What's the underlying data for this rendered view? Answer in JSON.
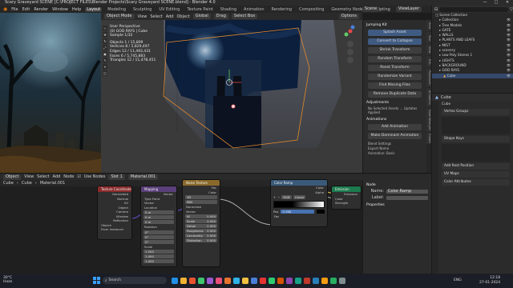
{
  "window": {
    "title": "Scary Graveyard SCENE [C:\\PROJECT FILES\\Blender Projects\\Scary Graveyard SCENE.blend] - Blender 4.0",
    "controls": [
      "—",
      "□",
      "✕"
    ]
  },
  "menubar": {
    "items": [
      "File",
      "Edit",
      "Render",
      "Window",
      "Help"
    ],
    "workspaces": [
      "Layout",
      "Modeling",
      "Sculpting",
      "UV Editing",
      "Texture Paint",
      "Shading",
      "Animation",
      "Rendering",
      "Compositing",
      "Geometry Nodes",
      "Scripting"
    ],
    "active_workspace": "Layout",
    "scene": "Scene",
    "view_layer": "ViewLayer"
  },
  "viewport_header": {
    "items": [
      "Object Mode",
      "View",
      "Select",
      "Add",
      "Object"
    ],
    "orientation": "Global",
    "drag": "Drag",
    "snap": "Select Box",
    "options": "Options"
  },
  "viewport_stats": {
    "lines": [
      "User Perspective",
      "(0) GOD RAYS | Cube",
      "Sample 1/32",
      "",
      "Objects    1 / 15,809",
      "Vertices   8 / 5,829,497",
      "Edges     12 / 11,492,431",
      "Faces      6 / 5,745,883",
      "Triangles  12 / 11,478,451"
    ]
  },
  "npanel": {
    "header": "Jumping Kit",
    "buttons": [
      "Splash Asset",
      "Convert to Collapse",
      "Shrink Transform",
      "Random Transform",
      "Reset Transform",
      "Randomize Variant",
      "Find Missing Files",
      "Remove Duplicate Data"
    ],
    "adjustments_label": "Adjustments",
    "adjustments_note": "No Selected Assets ... Updates Applied",
    "animations_label": "Animations",
    "add_animation": "Add Animation",
    "motion_label": "Make Dominant Animation",
    "fields": [
      "Blend Settings",
      "Export Name",
      "Animation: Basis"
    ]
  },
  "tools": [
    "⊹",
    "✥",
    "↻",
    "⤢",
    "▣",
    "✎",
    "⌖",
    "◫"
  ],
  "side_tabs": [
    "Item",
    "Tool",
    "View",
    "Edit",
    "Polyhaven",
    "Animation",
    "Node Wrangler",
    "Create"
  ],
  "outliner": {
    "search_placeholder": "",
    "rows": [
      {
        "name": "Scene Collection",
        "indent": 0
      },
      {
        "name": "Collection",
        "indent": 1
      },
      {
        "name": "Tree Models",
        "indent": 1
      },
      {
        "name": "GATE",
        "indent": 1
      },
      {
        "name": "WALLS",
        "indent": 1
      },
      {
        "name": "PLANTS AND LEAFS",
        "indent": 1
      },
      {
        "name": "MIST",
        "indent": 1
      },
      {
        "name": "scenery",
        "indent": 1
      },
      {
        "name": "Low Poly Stones 1",
        "indent": 1
      },
      {
        "name": "LIGHTS",
        "indent": 1
      },
      {
        "name": "BACKGROUND",
        "indent": 1
      },
      {
        "name": "GOD RAYS",
        "indent": 1
      },
      {
        "name": "Cube",
        "indent": 2,
        "selected": true
      }
    ]
  },
  "node_editor": {
    "header": [
      "Object",
      "View",
      "Select",
      "Add",
      "Node",
      "Use Nodes"
    ],
    "object": "Cube",
    "material": "Material.001",
    "slot": "Slot 1",
    "nodes": {
      "texcoord": {
        "title": "Texture Coordinate",
        "outputs": [
          "Generated",
          "Normal",
          "UV",
          "Object",
          "Camera",
          "Window",
          "Reflection"
        ],
        "object_label": "Object:",
        "from_instancer": "From Instancer"
      },
      "mapping": {
        "title": "Mapping",
        "output": "Vector",
        "type_label": "Type",
        "type_value": "Point",
        "vector": "Vector",
        "location": "Location",
        "rotation": "Rotation",
        "scale": "Scale",
        "vals_loc": [
          "0 m",
          "0 m",
          "0 m"
        ],
        "vals_rot": [
          "0°",
          "0°",
          "0°"
        ],
        "vals_scale": [
          "1.000",
          "1.000",
          "1.000"
        ]
      },
      "noise": {
        "title": "Noise Texture",
        "outputs": [
          "Fac",
          "Color"
        ],
        "dim": "3D",
        "type": "fBM",
        "normalize": "Normalize",
        "vector": "Vector",
        "fields": [
          {
            "k": "W",
            "v": "0.000"
          },
          {
            "k": "Scale",
            "v": "4.000"
          },
          {
            "k": "Detail",
            "v": "2.000"
          },
          {
            "k": "Roughness",
            "v": "0.500"
          },
          {
            "k": "Lacunarity",
            "v": "2.000"
          },
          {
            "k": "Distortion",
            "v": "0.000"
          }
        ]
      },
      "colorramp": {
        "title": "Color Ramp",
        "outputs": [
          "Color",
          "Alpha"
        ],
        "mode": "RGB",
        "interp": "Linear",
        "pos_label": "Pos",
        "pos_value": "0.368",
        "fac": "Fac"
      },
      "emission": {
        "title": "Emission",
        "output": "Emission",
        "inputs": [
          "Color",
          "Strength"
        ]
      },
      "output": {
        "title": "Material Output",
        "target": "All",
        "inputs": [
          "Surface",
          "Volume",
          "Displacement"
        ]
      }
    },
    "side": {
      "title": "Node",
      "name_label": "Name:",
      "name_value": "Color Ramp",
      "label_label": "Label:",
      "properties": "Properties"
    }
  },
  "properties": {
    "object": "Cube",
    "panels": [
      "Vertex Groups",
      "Shape Keys",
      "Add Rest Position",
      "UV Maps",
      "Color Attributes"
    ]
  },
  "taskbar": {
    "weather": "30°C",
    "weather_sub": "Haze",
    "search": "Search",
    "time": "12:18",
    "date": "27-01-2024",
    "lang": "ENG",
    "icon_colors": [
      "#1f8fe6",
      "#f2b233",
      "#e8532f",
      "#3ec46d",
      "#9b59d0",
      "#e84e7a",
      "#e6742e",
      "#2fb3e6",
      "#f0c040",
      "#4a7fd8",
      "#e63232",
      "#2ecc71",
      "#d35400",
      "#8e44ad",
      "#16a085",
      "#c0392b",
      "#2980b9",
      "#f39c12",
      "#27ae60",
      "#7f8c8d"
    ]
  },
  "colors": {
    "accent": "#4772b3",
    "selection": "#34496b",
    "orange_select": "#e38a2c",
    "node_green": "#1c7a4e",
    "node_red": "#8a2b2b",
    "node_blue": "#3a5a7a",
    "node_purple": "#5a3f7a"
  }
}
